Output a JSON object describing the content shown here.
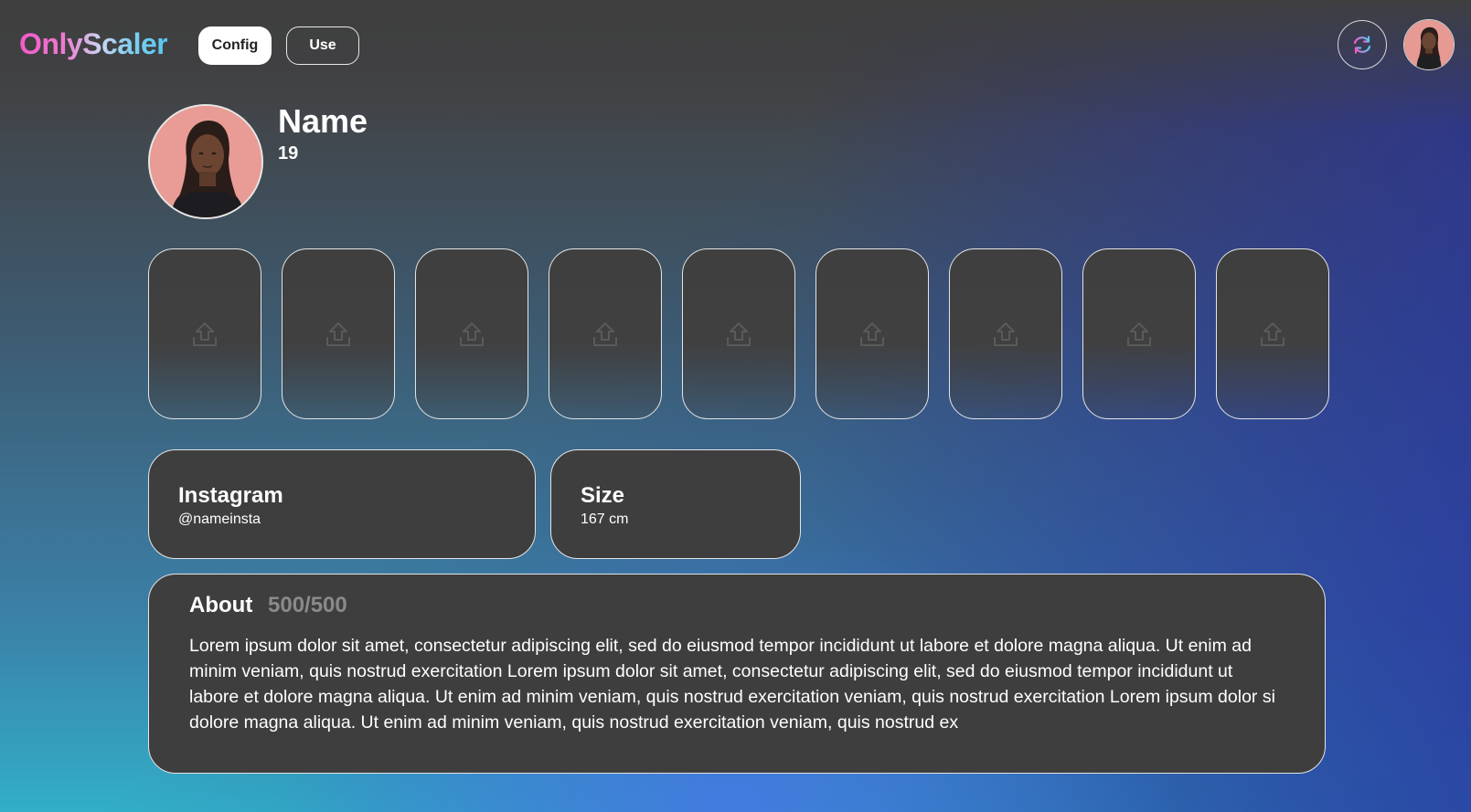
{
  "app": {
    "logo": "OnlyScaler",
    "logo_gradient": [
      "#f25bc8",
      "#57c8f0"
    ]
  },
  "nav": {
    "config_label": "Config",
    "use_label": "Use",
    "active": "Config"
  },
  "header_actions": {
    "refresh_icon": "refresh-icon",
    "avatar_icon": "user-avatar"
  },
  "profile": {
    "name": "Name",
    "age": "19",
    "photo": "profile-photo"
  },
  "photo_slots": {
    "count": 9,
    "icon": "upload-icon"
  },
  "instagram": {
    "title": "Instagram",
    "value": "@nameinsta"
  },
  "size": {
    "title": "Size",
    "value": "167 cm"
  },
  "about": {
    "title": "About",
    "count": "500/500",
    "text": "Lorem ipsum dolor sit amet, consectetur adipiscing elit, sed do eiusmod tempor incididunt ut labore et dolore magna aliqua. Ut enim ad\nminim veniam, quis nostrud exercitation Lorem ipsum dolor sit amet, consectetur adipiscing elit, sed do eiusmod tempor incididunt ut\nlabore et dolore magna aliqua. Ut enim ad minim veniam, quis nostrud exercitation veniam, quis nostrud exercitation Lorem ipsum dolor si\ndolore magna aliqua. Ut enim ad minim veniam, quis nostrud exercitation veniam, quis nostrud ex"
  },
  "colors": {
    "card_bg": "#3e3e3e",
    "border": "#e4e4e4",
    "muted_text": "#8a8a8a"
  }
}
